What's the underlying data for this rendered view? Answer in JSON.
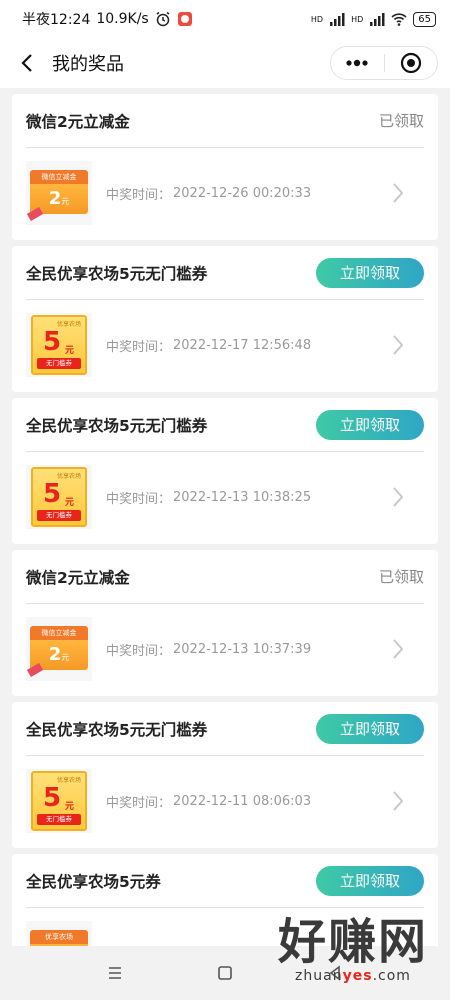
{
  "status_bar": {
    "time": "半夜12:24",
    "speed": "10.9K/s",
    "battery": "65",
    "signal1": "HD",
    "signal2": "HD"
  },
  "nav": {
    "title": "我的奖品"
  },
  "win_label": "中奖时间：",
  "prizes": [
    {
      "title": "微信2元立减金",
      "status": "已领取",
      "claimed": true,
      "type": "wechat",
      "time": "2022-12-26 00:20:33"
    },
    {
      "title": "全民优享农场5元无门槛券",
      "status": "立即领取",
      "claimed": false,
      "type": "farm",
      "time": "2022-12-17 12:56:48"
    },
    {
      "title": "全民优享农场5元无门槛券",
      "status": "立即领取",
      "claimed": false,
      "type": "farm",
      "time": "2022-12-13 10:38:25"
    },
    {
      "title": "微信2元立减金",
      "status": "已领取",
      "claimed": true,
      "type": "wechat",
      "time": "2022-12-13 10:37:39"
    },
    {
      "title": "全民优享农场5元无门槛券",
      "status": "立即领取",
      "claimed": false,
      "type": "farm",
      "time": "2022-12-11 08:06:03"
    },
    {
      "title": "全民优享农场5元券",
      "status": "立即领取",
      "claimed": false,
      "type": "farm",
      "time": ""
    }
  ],
  "coupon_art": {
    "wechat_top": "微信立减金",
    "wechat_amount": "2",
    "wechat_unit": "元",
    "farm_brand": "优享农场",
    "farm_amount": "5",
    "farm_unit": "元",
    "farm_tag": "无门槛券"
  },
  "watermark": {
    "main": "好赚网",
    "url_a": "zhuan",
    "url_b": "yes",
    "url_c": ".com"
  },
  "colors": {
    "claim_gradient_start": "#3fc9a5",
    "claim_gradient_end": "#2fa6c6",
    "claimed_text": "#888888"
  }
}
